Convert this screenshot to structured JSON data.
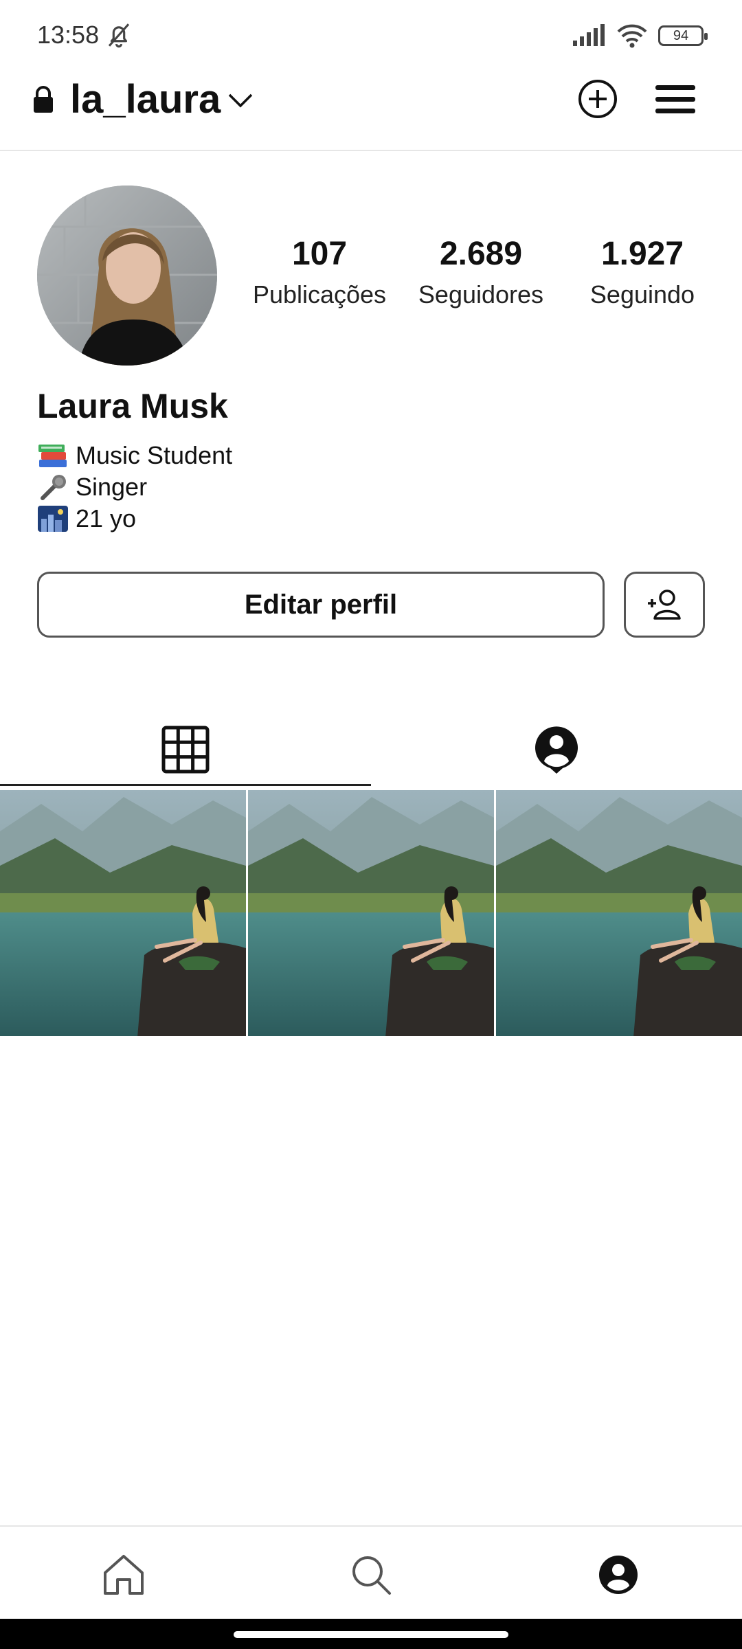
{
  "status_bar": {
    "time": "13:58",
    "battery": "94"
  },
  "header": {
    "username": "la_laura"
  },
  "profile": {
    "stats": [
      {
        "value": "107",
        "label": "Publicações"
      },
      {
        "value": "2.689",
        "label": "Seguidores"
      },
      {
        "value": "1.927",
        "label": "Seguindo"
      }
    ],
    "display_name": "Laura Musk",
    "bio": [
      {
        "icon": "books-icon",
        "text": "Music Student"
      },
      {
        "icon": "microphone-icon",
        "text": "Singer"
      },
      {
        "icon": "night-city-icon",
        "text": "21 yo"
      }
    ]
  },
  "actions": {
    "edit_profile_label": "Editar perfil"
  },
  "tabs": [
    {
      "icon": "grid-icon",
      "active": true
    },
    {
      "icon": "tagged-icon",
      "active": false
    }
  ],
  "posts": [
    {
      "icon": "photo-lake-thumbnail"
    },
    {
      "icon": "photo-lake-thumbnail"
    },
    {
      "icon": "photo-lake-thumbnail"
    }
  ],
  "bottom_nav": [
    {
      "icon": "home-icon"
    },
    {
      "icon": "search-icon"
    },
    {
      "icon": "profile-icon",
      "active": true
    }
  ],
  "colors": {
    "text": "#111111",
    "border": "#555555",
    "divider": "#e6e6e6"
  }
}
